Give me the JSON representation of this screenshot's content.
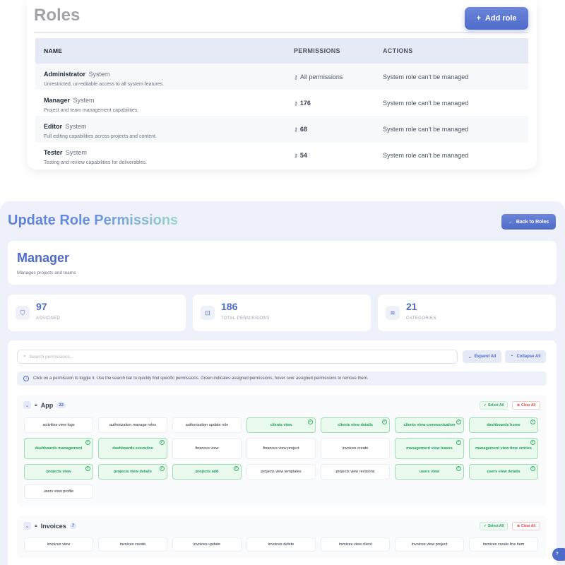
{
  "roles": {
    "title": "Roles",
    "add_button": "Add role",
    "columns": [
      "NAME",
      "PERMISSIONS",
      "ACTIONS"
    ],
    "rows": [
      {
        "name": "Administrator",
        "tag": "System",
        "desc": "Unrestricted, un-editable access to all system features.",
        "perms": "All permissions",
        "action": "System role can't be managed"
      },
      {
        "name": "Manager",
        "tag": "System",
        "desc": "Project and team management capabilities.",
        "perms": "176",
        "action": "System role can't be managed"
      },
      {
        "name": "Editor",
        "tag": "System",
        "desc": "Full editing capabilities across projects and content.",
        "perms": "68",
        "action": "System role can't be managed"
      },
      {
        "name": "Tester",
        "tag": "System",
        "desc": "Testing and review capabilities for deliverables.",
        "perms": "54",
        "action": "System role can't be managed"
      }
    ]
  },
  "update": {
    "title": "Update Role Permissions",
    "back_button": "Back to Roles",
    "role_name": "Manager",
    "role_desc": "Manages projects and teams",
    "stats": [
      {
        "value": "97",
        "label": "ASSIGNED",
        "icon": "shield-icon"
      },
      {
        "value": "186",
        "label": "TOTAL PERMISSIONS",
        "icon": "lock-icon"
      },
      {
        "value": "21",
        "label": "CATEGORIES",
        "icon": "layers-icon"
      }
    ],
    "search_placeholder": "Search permissions...",
    "expand_all": "Expand All",
    "collapse_all": "Collapse All",
    "info": "Click on a permission to toggle it. Use the search bar to quickly find specific permissions. Green indicates assigned permissions, hover over assigned permissions to remove them.",
    "select_all": "Select All",
    "clear_all": "Clear All",
    "categories": [
      {
        "name": "App",
        "count": "22",
        "chips": [
          {
            "label": "activities view logs",
            "on": false
          },
          {
            "label": "authorization manage roles",
            "on": false
          },
          {
            "label": "authorization update role",
            "on": false
          },
          {
            "label": "clients view",
            "on": true
          },
          {
            "label": "clients view details",
            "on": true
          },
          {
            "label": "clients view communication",
            "on": true
          },
          {
            "label": "dashboards home",
            "on": true
          },
          {
            "label": "dashboards management",
            "on": true
          },
          {
            "label": "dashboards executive",
            "on": true
          },
          {
            "label": "finances view",
            "on": false
          },
          {
            "label": "finances view project",
            "on": false
          },
          {
            "label": "invoices create",
            "on": false
          },
          {
            "label": "management view leaves",
            "on": true
          },
          {
            "label": "management view time entries",
            "on": true
          },
          {
            "label": "projects view",
            "on": true
          },
          {
            "label": "projects view details",
            "on": true
          },
          {
            "label": "projects add",
            "on": true
          },
          {
            "label": "projects view templates",
            "on": false
          },
          {
            "label": "projects view revisions",
            "on": false
          },
          {
            "label": "users view",
            "on": true
          },
          {
            "label": "users view details",
            "on": true
          },
          {
            "label": "users view profile",
            "on": false
          }
        ]
      },
      {
        "name": "Invoices",
        "count": "7",
        "chips": [
          {
            "label": "invoices view",
            "on": false
          },
          {
            "label": "invoices create",
            "on": false
          },
          {
            "label": "invoices update",
            "on": false
          },
          {
            "label": "invoices delete",
            "on": false
          },
          {
            "label": "invoices view client",
            "on": false
          },
          {
            "label": "invoices view project",
            "on": false
          },
          {
            "label": "invoices create line item",
            "on": false
          }
        ]
      }
    ],
    "help_label": "?"
  }
}
